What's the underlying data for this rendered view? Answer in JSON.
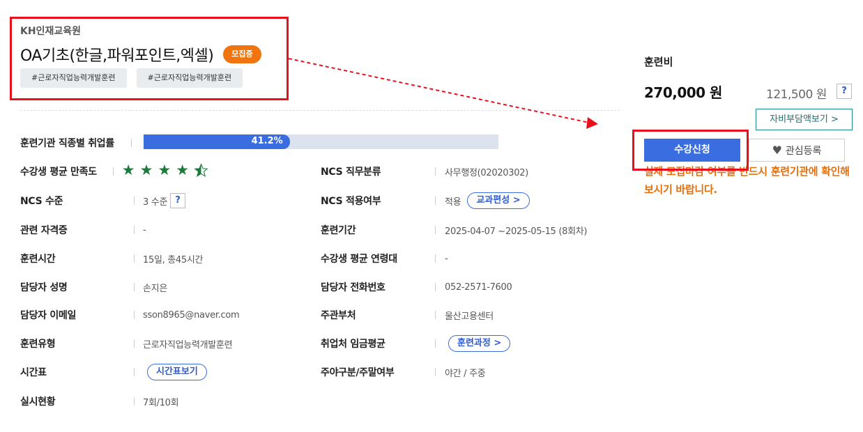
{
  "header": {
    "org": "KH인재교육원",
    "title": "OA기초(한글,파워포인트,엑셀)",
    "status_badge": "모집중",
    "tags": [
      "#근로자직업능력개발훈련",
      "#근로자직업능력개발훈련"
    ]
  },
  "employment_rate": {
    "label": "훈련기관 직종별 취업률",
    "value_text": "41.2%",
    "value": 41.2
  },
  "satisfaction": {
    "label": "수강생 평균 만족도",
    "rating": 4.5,
    "max": 5
  },
  "left_rows": [
    {
      "label": "NCS 수준",
      "value": "3 수준",
      "help": "?"
    },
    {
      "label": "관련 자격증",
      "value": "-"
    },
    {
      "label": "훈련시간",
      "value": "15일, 총45시간"
    },
    {
      "label": "담당자 성명",
      "value": "손지은"
    },
    {
      "label": "담당자 이메일",
      "value": "sson8965@naver.com"
    },
    {
      "label": "훈련유형",
      "value": "근로자직업능력개발훈련"
    },
    {
      "label": "시간표",
      "button": "시간표보기"
    },
    {
      "label": "실시현황",
      "value": "7회/10회"
    }
  ],
  "right_rows": [
    {
      "label": "NCS 직무분류",
      "value": "사무행정(02020302)"
    },
    {
      "label": "NCS 적용여부",
      "value": "적용",
      "button": "교과편성 >"
    },
    {
      "label": "훈련기간",
      "value": "2025-04-07 ~2025-05-15 (8회차)"
    },
    {
      "label": "수강생 평균 연령대",
      "value": "-"
    },
    {
      "label": "담당자 전화번호",
      "value": "052-2571-7600"
    },
    {
      "label": "주관부처",
      "value": "울산고용센터"
    },
    {
      "label": "취업처 임금평균",
      "button": "훈련과정 >"
    },
    {
      "label": "주야구분/주말여부",
      "value": "야간 / 주중"
    }
  ],
  "fee": {
    "label": "훈련비",
    "amount": "270,000 원",
    "self_amount": "121,500 원",
    "help": "?",
    "self_button": "자비부담액보기 >",
    "apply_button": "수강신청",
    "favorite_button": "관심등록",
    "notice": "실제 모집마감 여부를 반드시 훈련기관에 확인해보시기 바랍니다."
  },
  "colors": {
    "accent_blue": "#3a6ee0",
    "badge_orange": "#f0750f",
    "star_green": "#1c7a3a",
    "notice_orange": "#e07010",
    "annotation_red": "#e8101c"
  }
}
